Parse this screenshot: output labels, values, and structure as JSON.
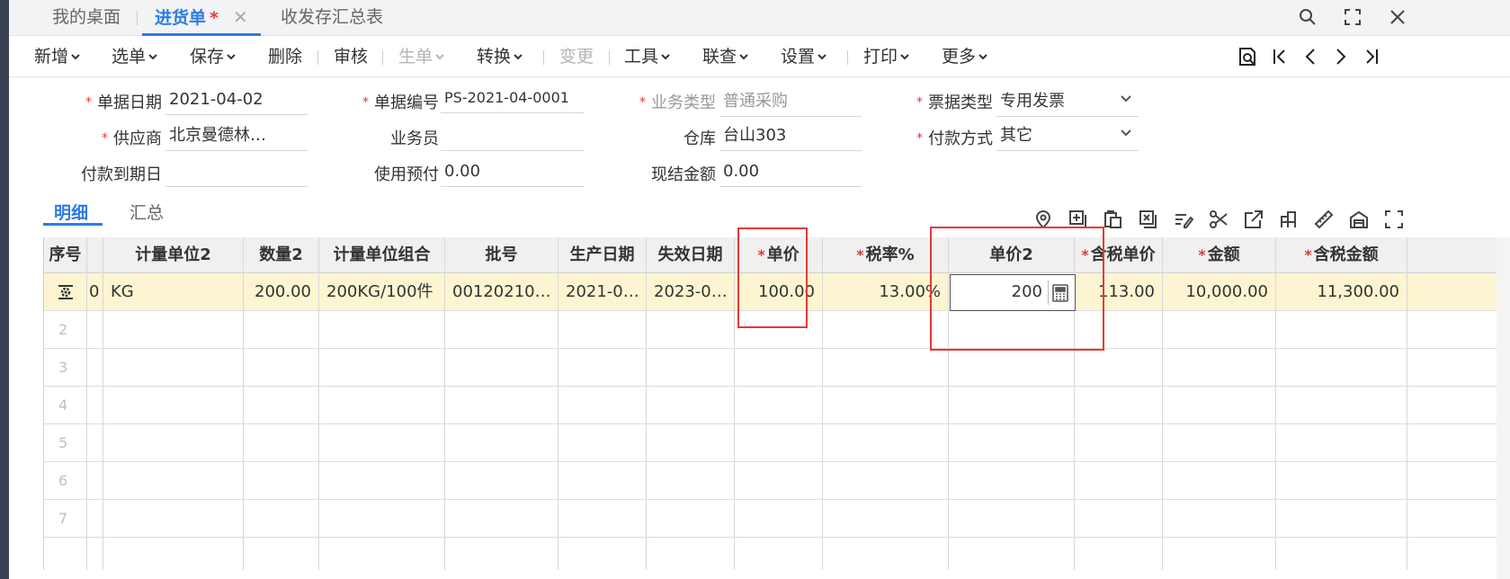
{
  "tabs": [
    {
      "label": "我的桌面"
    },
    {
      "label": "进货单",
      "star": "*",
      "close": "✕"
    },
    {
      "label": "收发存汇总表"
    }
  ],
  "toolbar": {
    "items": [
      "新增",
      "选单",
      "保存",
      "删除",
      "审核",
      "生单",
      "转换",
      "变更",
      "工具",
      "联查",
      "设置",
      "打印",
      "更多"
    ]
  },
  "form": {
    "date": {
      "label": "单据日期",
      "value": "2021-04-02"
    },
    "number": {
      "label": "单据编号",
      "value": "PS-2021-04-0001"
    },
    "biztype": {
      "label": "业务类型",
      "value": "普通采购"
    },
    "invoice": {
      "label": "票据类型",
      "value": "专用发票"
    },
    "supplier": {
      "label": "供应商",
      "value": "北京曼德林…"
    },
    "salesman": {
      "label": "业务员",
      "value": ""
    },
    "warehouse": {
      "label": "仓库",
      "value": "台山303"
    },
    "payment": {
      "label": "付款方式",
      "value": "其它"
    },
    "duedate": {
      "label": "付款到期日",
      "value": ""
    },
    "prepay": {
      "label": "使用预付",
      "value": "0.00"
    },
    "settled": {
      "label": "现结金额",
      "value": "0.00"
    }
  },
  "subtabs": [
    "明细",
    "汇总"
  ],
  "grid": {
    "headers": {
      "seq": "序号",
      "unit2": "计量单位2",
      "qty2": "数量2",
      "unitgroup": "计量单位组合",
      "batch": "批号",
      "mfgdate": "生产日期",
      "expdate": "失效日期",
      "price": "单价",
      "taxrate": "税率%",
      "price2": "单价2",
      "taxprice": "含税单价",
      "amount": "金额",
      "taxamount": "含税金额"
    },
    "row1": {
      "partial": "0",
      "unit2": "KG",
      "qty2": "200.00",
      "unitgroup": "200KG/100件",
      "batch": "00120210…",
      "mfgdate": "2021-0…",
      "expdate": "2023-0…",
      "price": "100.00",
      "taxrate": "13.00%",
      "price2": "200",
      "taxprice": "113.00",
      "amount": "10,000.00",
      "taxamount": "11,300.00"
    },
    "row_numbers": [
      "2",
      "3",
      "4",
      "5",
      "6",
      "7"
    ]
  },
  "required_mark": "*",
  "colors": {
    "accent": "#2d7be5",
    "required": "#e53935",
    "highlight": "#fdf5d2",
    "annotation": "#e53935"
  }
}
